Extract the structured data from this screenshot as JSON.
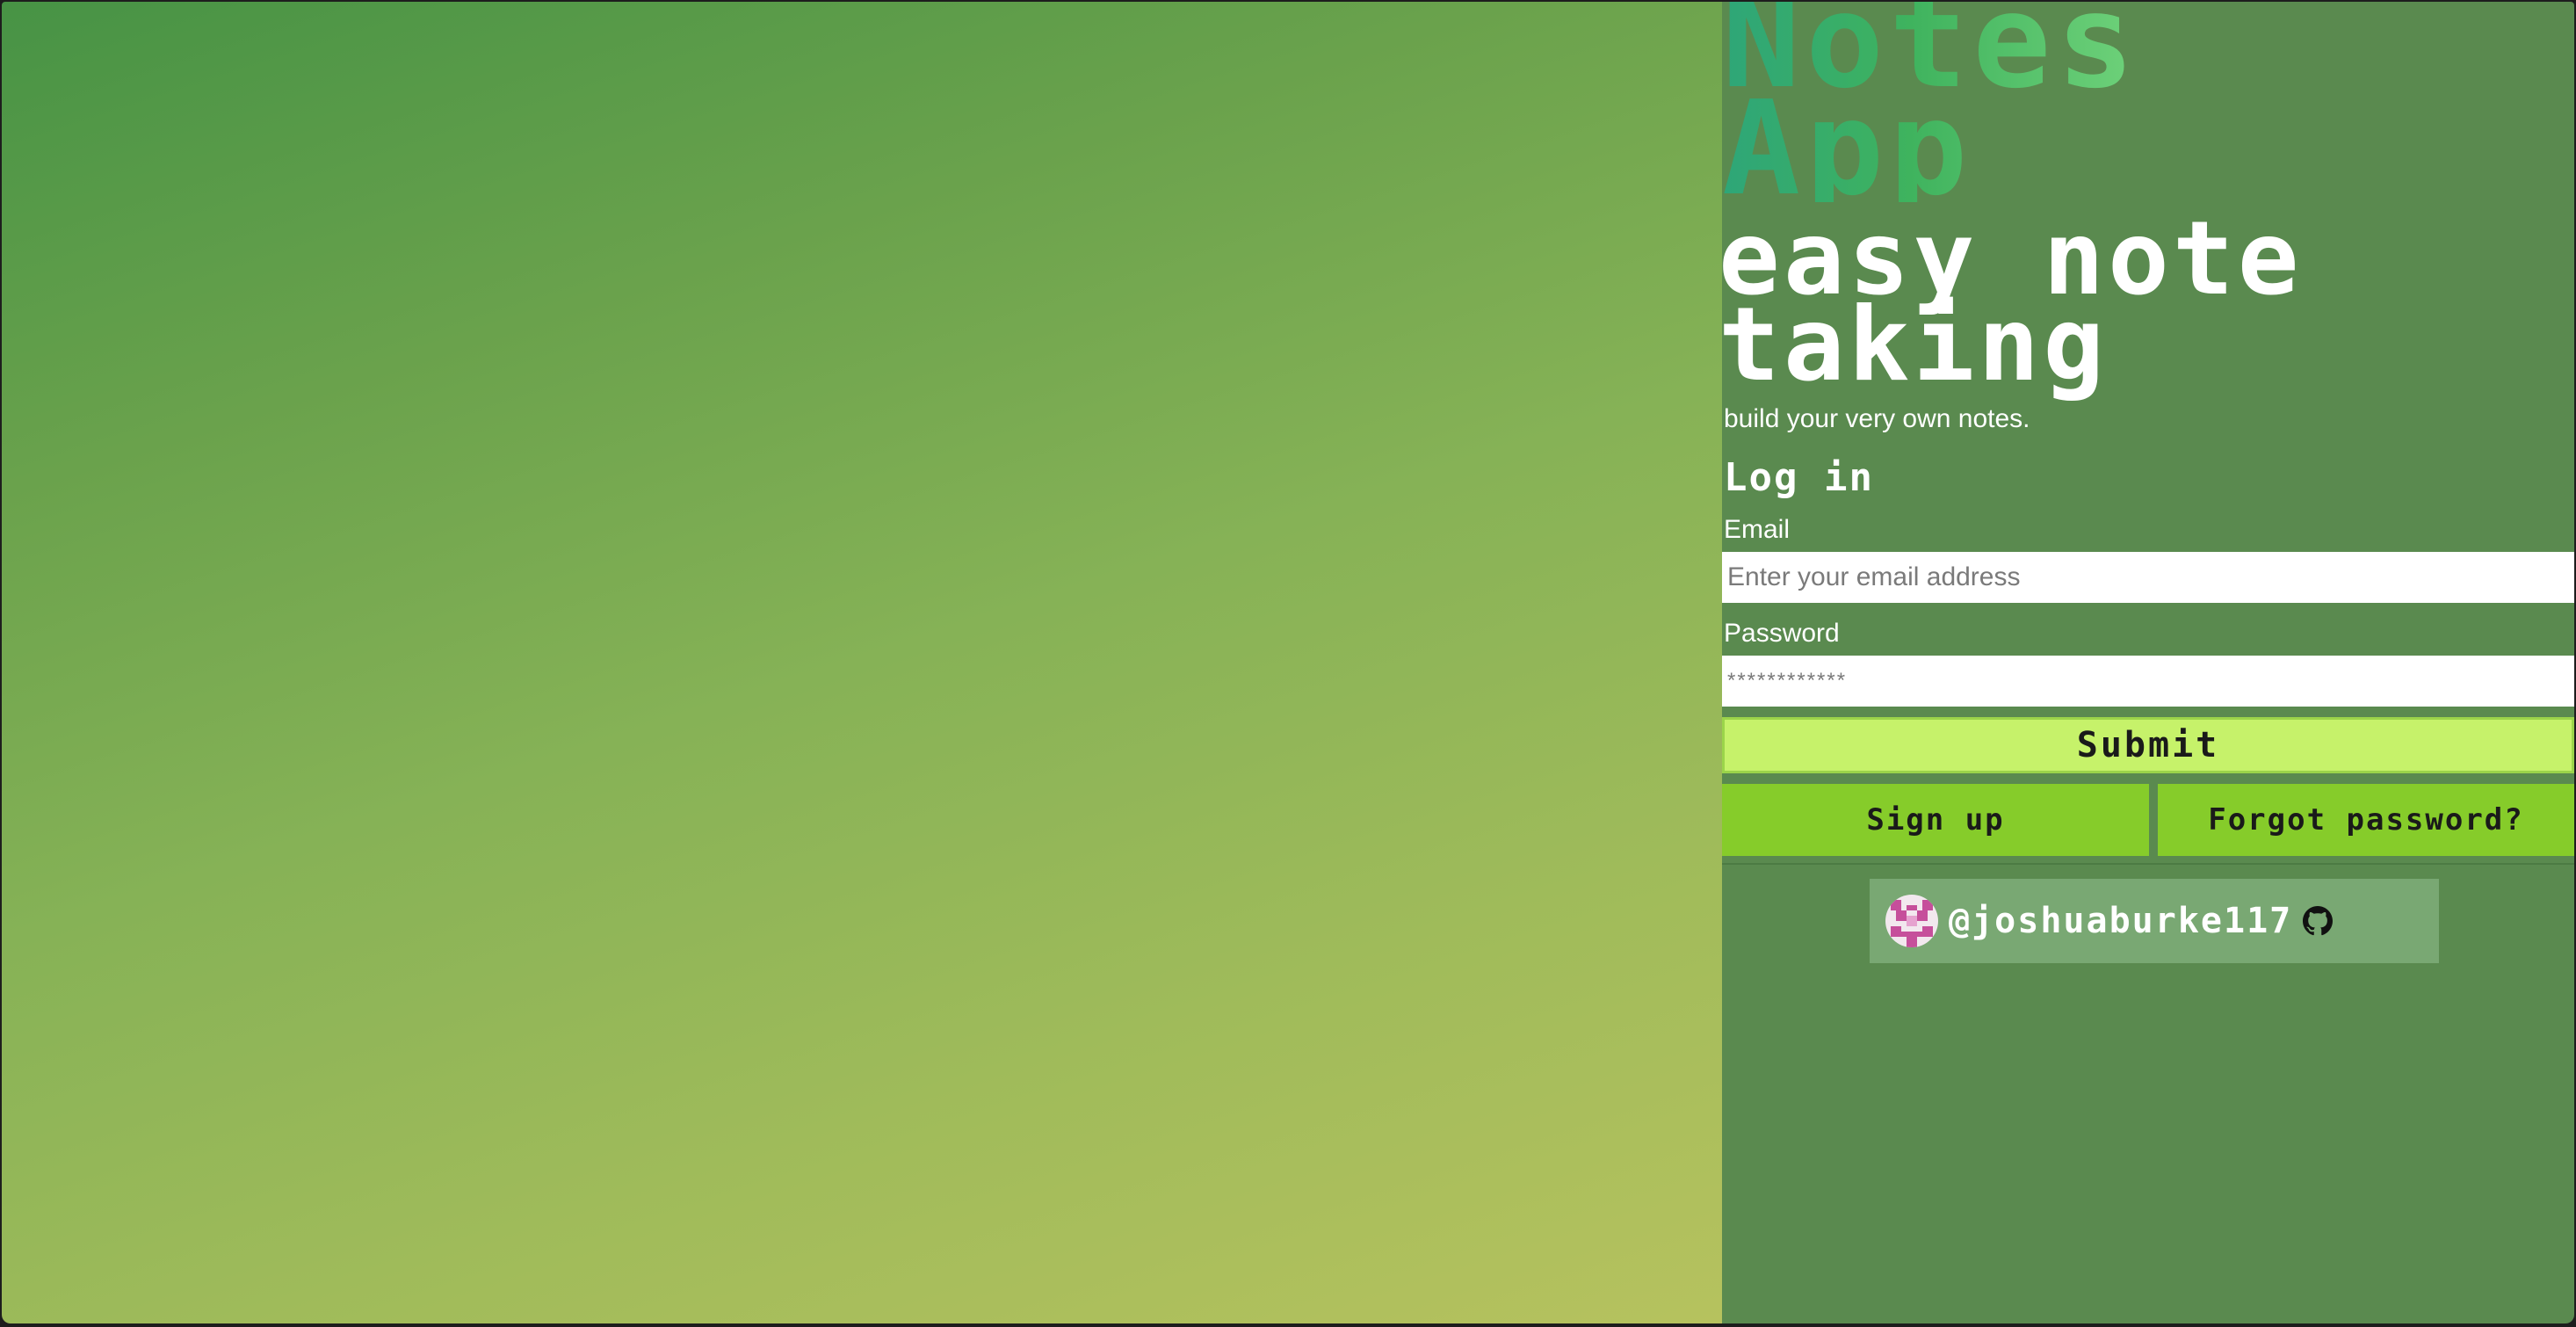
{
  "app": {
    "title_line1": "Notes",
    "title_line2": "App",
    "tagline_line1": "easy note",
    "tagline_line2": "taking",
    "subtitle": "build your very own notes."
  },
  "login": {
    "heading": "Log in",
    "email_label": "Email",
    "email_placeholder": "Enter your email address",
    "password_label": "Password",
    "password_placeholder": "************",
    "submit_label": "Submit",
    "signup_label": "Sign up",
    "forgot_label": "Forgot password?"
  },
  "credit": {
    "username": "@joshuaburke117",
    "avatar_icon": "pixel-avatar-icon",
    "link_icon": "github-icon"
  },
  "colors": {
    "side_panel": "#5a8a4f",
    "submit_button": "#c6f26a",
    "action_buttons": "#86cc2a",
    "credit_badge": "#79a873",
    "title_gradient_start": "#2ea678",
    "title_gradient_end": "#6fd27a"
  }
}
